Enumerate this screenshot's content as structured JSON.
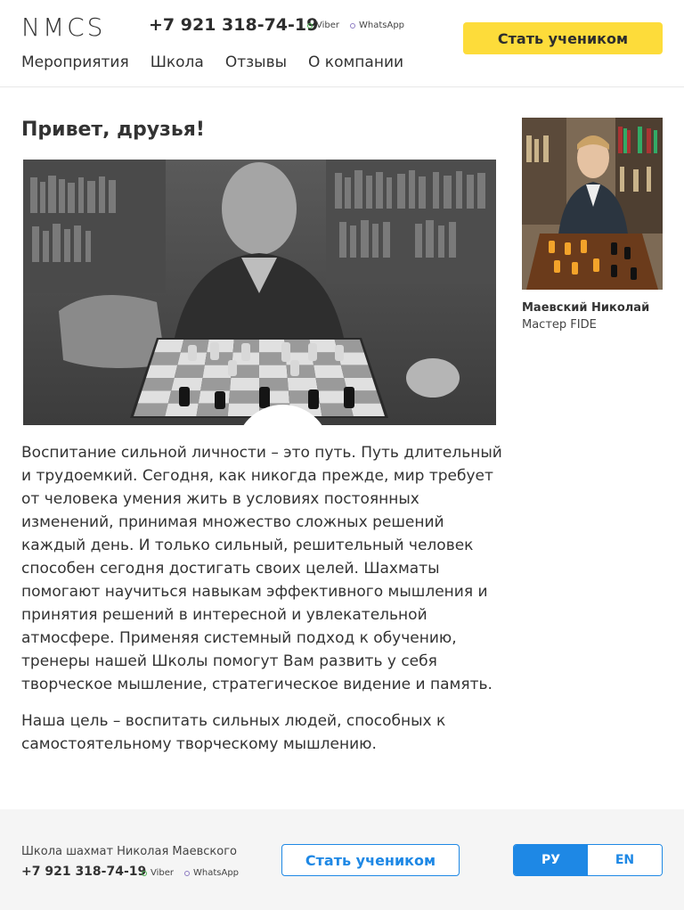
{
  "header": {
    "logo": "NMCS",
    "phone": "+7 921 318-74-19",
    "messengers": [
      "Viber",
      "WhatsApp"
    ],
    "cta": "Стать учеником",
    "nav": [
      "Мероприятия",
      "Школа",
      "Отзывы",
      "О компании"
    ]
  },
  "main": {
    "greeting": "Привет, друзья!",
    "paragraphs": [
      "Воспитание сильной личности – это путь. Путь длительный и трудоемкий. Сегодня, как никогда прежде, мир требует от человека умения жить в условиях постоянных изменений, принимая множество сложных решений каждый день. И только сильный, решительный человек способен сегодня достигать своих целей. Шахматы помогают научиться навыкам эффективного мышления и принятия решений в интересной и увлекательной атмосфере. Применяя системный подход к обучению, тренеры нашей Школы помогут Вам развить у себя творческое мышление, стратегическое видение и память.",
      "Наша цель – воспитать сильных людей, способных к самостоятельному творческому мышлению."
    ]
  },
  "coach": {
    "name": "Маевский Николай",
    "title": "Мастер FIDE"
  },
  "footer": {
    "school": "Школа шахмат Николая Маевского",
    "phone": "+7 921 318-74-19",
    "messengers": [
      "Viber",
      "WhatsApp"
    ],
    "cta": "Стать учеником",
    "languages": [
      "РУ",
      "EN"
    ]
  },
  "colors": {
    "accent_yellow": "#fddc3a",
    "accent_blue": "#1e88e5",
    "viber_dot": "#4caf50",
    "whatsapp_dot": "#8e7cc3"
  }
}
